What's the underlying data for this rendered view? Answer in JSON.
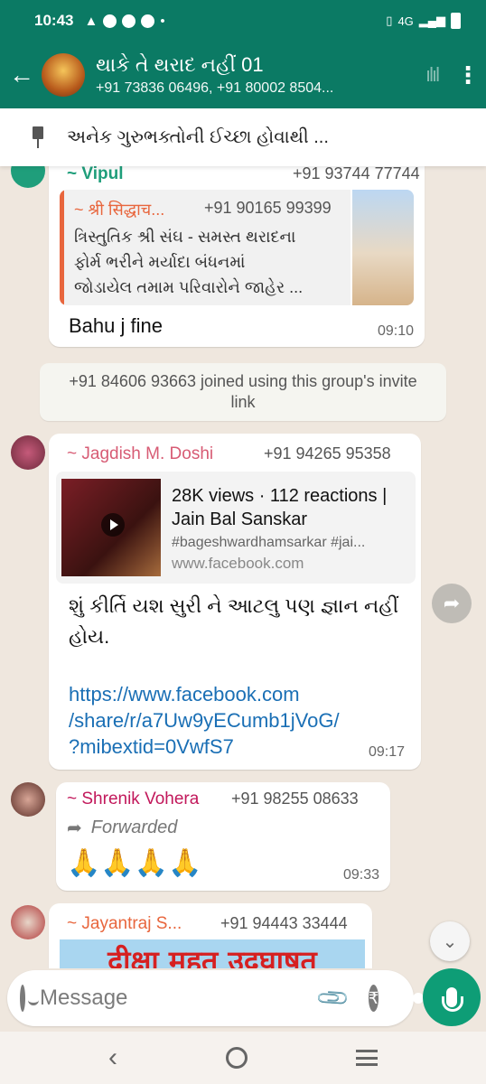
{
  "status_bar": {
    "time": "10:43",
    "network": "4G"
  },
  "header": {
    "title": "થાકે તે થરાદ નહીં 01",
    "subtitle": "+91 73836 06496, +91 80002 8504..."
  },
  "pinned": {
    "text": "અનેક ગુરુભક્તોની ઈચ્છા હોવાથી ..."
  },
  "messages": [
    {
      "sender": "~ Vipul",
      "phone": "+91 93744 77744",
      "quote_sender": "~ श्री सिद्धाच...",
      "quote_phone": "+91 90165 99399",
      "quote_lines": [
        "ત્રિસ્તુતિક શ્રી સંઘ - સમસ્ત થરાદના",
        "ફોર્મ ભરીને મર્યાદા બંધનમાં",
        "જોડાયેલ તમામ પરિવારોને જાહેર ..."
      ],
      "text": "Bahu j fine",
      "time": "09:10"
    },
    {
      "system_text": "+91 84606 93663 joined using this group's invite link"
    },
    {
      "sender": "~ Jagdish M. Doshi",
      "phone": "+91 94265 95358",
      "link_title": "28K views · 112 reactions | Jain Bal Sanskar",
      "link_desc": "#bageshwardhamsarkar #jai...",
      "link_domain": "www.facebook.com",
      "text": "શું કીર્તિ યશ સુરી ને આટલુ પણ જ્ઞાન નહીં હોય.",
      "link_lines": [
        "https://www.facebook.com",
        "/share/r/a7Uw9yECumb1jVoG/",
        "?mibextid=0VwfS7"
      ],
      "time": "09:17"
    },
    {
      "sender": "~ Shrenik Vohera",
      "phone": "+91 98255 08633",
      "forwarded": "Forwarded",
      "text": "🙏🙏🙏🙏",
      "time": "09:33"
    },
    {
      "sender": "~ Jayantraj S...",
      "phone": "+91 94443 33444",
      "image_text": "दीक्षा महत उदघाषत"
    }
  ],
  "input": {
    "placeholder": "Message"
  },
  "colors": {
    "header_bg": "#0b7a64",
    "vipul": "#1f9e7b",
    "quote_bar": "#e8663d",
    "jagdish": "#d75b74",
    "shrenik": "#c2185b",
    "jayantraj": "#e8663d",
    "link": "#1a6fb5",
    "mic": "#0e9d76"
  }
}
